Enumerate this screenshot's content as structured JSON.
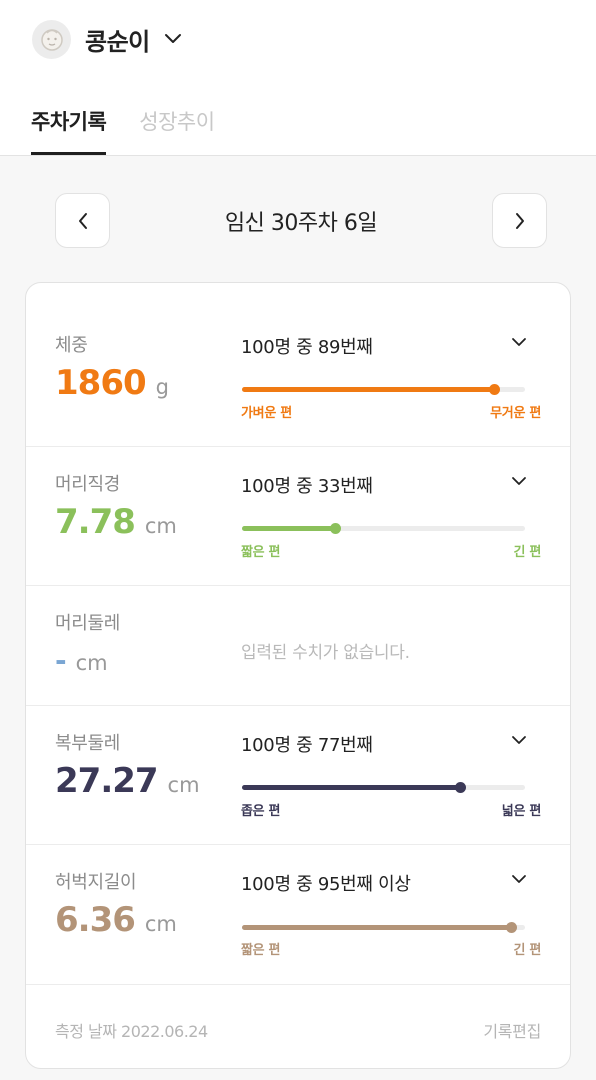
{
  "header": {
    "profile_name": "콩순이",
    "tabs": [
      {
        "label": "주차기록"
      },
      {
        "label": "성장추이"
      }
    ]
  },
  "week_nav": {
    "title": "임신 30주차 6일"
  },
  "metrics": [
    {
      "label": "체중",
      "value": "1860",
      "unit": "g",
      "rank": "100명 중 89번째",
      "percentile": 0.89,
      "low_label": "가벼운 편",
      "high_label": "무거운 편",
      "color": "#f07a13"
    },
    {
      "label": "머리직경",
      "value": "7.78",
      "unit": "cm",
      "rank": "100명 중 33번째",
      "percentile": 0.33,
      "low_label": "짧은 편",
      "high_label": "긴 편",
      "color": "#8bc05b"
    },
    {
      "label": "머리둘레",
      "value": "-",
      "unit": "cm",
      "empty_message": "입력된 수치가 없습니다.",
      "color": "#7aa6d3"
    },
    {
      "label": "복부둘레",
      "value": "27.27",
      "unit": "cm",
      "rank": "100명 중 77번째",
      "percentile": 0.77,
      "low_label": "좁은 편",
      "high_label": "넓은 편",
      "color": "#3b3957"
    },
    {
      "label": "허벅지길이",
      "value": "6.36",
      "unit": "cm",
      "rank": "100명 중 95번째 이상",
      "percentile": 0.95,
      "low_label": "짧은 편",
      "high_label": "긴 편",
      "color": "#b39478"
    }
  ],
  "footer": {
    "measure_date": "측정 날짜 2022.06.24",
    "edit_label": "기록편집"
  },
  "icons": {
    "avatar": "baby-face-icon",
    "profile_dropdown": "chevron-down-icon",
    "prev": "chevron-left-icon",
    "next": "chevron-right-icon",
    "rank_expand": "chevron-down-icon"
  }
}
